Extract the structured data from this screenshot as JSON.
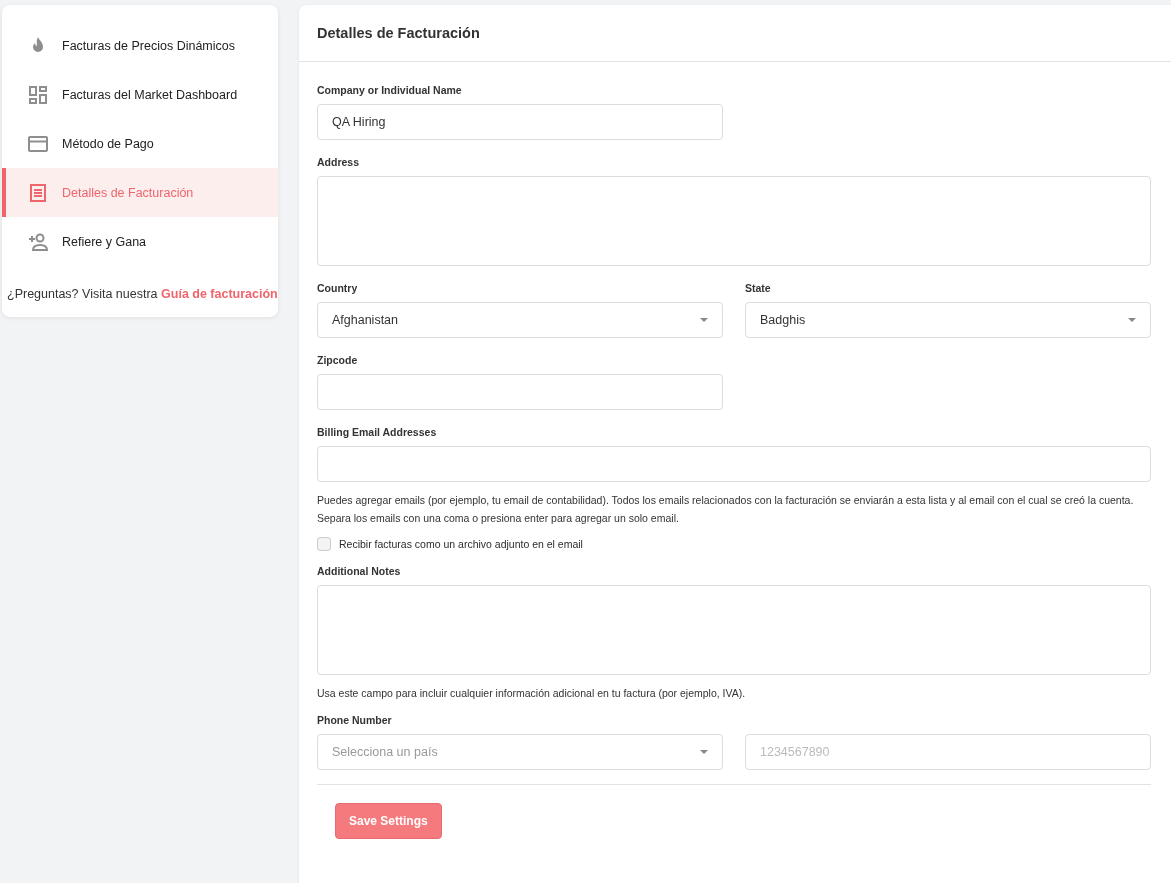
{
  "sidebar": {
    "items": [
      {
        "kind": "flame",
        "label": "Facturas de Precios Dinámicos",
        "selected": false
      },
      {
        "kind": "dashboard",
        "label": "Facturas del Market Dashboard",
        "selected": false
      },
      {
        "kind": "card",
        "label": "Método de Pago",
        "selected": false
      },
      {
        "kind": "receipt",
        "label": "Detalles de Facturación",
        "selected": true
      },
      {
        "kind": "person_add",
        "label": "Refiere y Gana",
        "selected": false
      }
    ],
    "help": {
      "text": "¿Preguntas? Visita nuestra",
      "link": "Guía de facturación"
    }
  },
  "form": {
    "title": "Detalles de Facturación",
    "sections": [
      {
        "kind": "fields",
        "fields": [
          {
            "kind": "input",
            "label": "Company or Individual Name",
            "value": "QA Hiring"
          }
        ]
      },
      {
        "kind": "fields",
        "fields": [
          {
            "kind": "textarea",
            "label": "Address"
          }
        ]
      },
      {
        "kind": "fields",
        "fields": [
          {
            "kind": "select",
            "label": "Country",
            "value": "Afghanistan"
          },
          {
            "kind": "select",
            "label": "State",
            "value": "Badghis"
          }
        ]
      },
      {
        "kind": "fields",
        "fields": [
          {
            "kind": "input",
            "label": "Zipcode"
          }
        ]
      },
      {
        "kind": "fields",
        "fields": [
          {
            "kind": "email_list",
            "label": "Billing Email Addresses"
          }
        ]
      },
      {
        "kind": "hint",
        "text": "Puedes agregar emails (por ejemplo, tu email de contabilidad). Todos los emails relacionados con la facturación se enviarán a esta lista y al email con el cual se creó la cuenta. Separa los emails con una coma o presiona enter para agregar un solo email."
      },
      {
        "kind": "checkbox",
        "label": "Recibir facturas como un archivo adjunto en el email",
        "checked": false
      },
      {
        "kind": "fields",
        "fields": [
          {
            "kind": "textarea",
            "label": "Additional Notes"
          }
        ]
      },
      {
        "kind": "hint",
        "text": "Usa este campo para incluir cualquier información adicional en tu factura (por ejemplo, IVA)."
      },
      {
        "kind": "fields",
        "label": "Phone Number",
        "fields": [
          {
            "kind": "select",
            "placeholder": "Selecciona un país"
          },
          {
            "kind": "input",
            "placeholder": "1234567890"
          }
        ]
      }
    ],
    "button": "Save Settings"
  }
}
